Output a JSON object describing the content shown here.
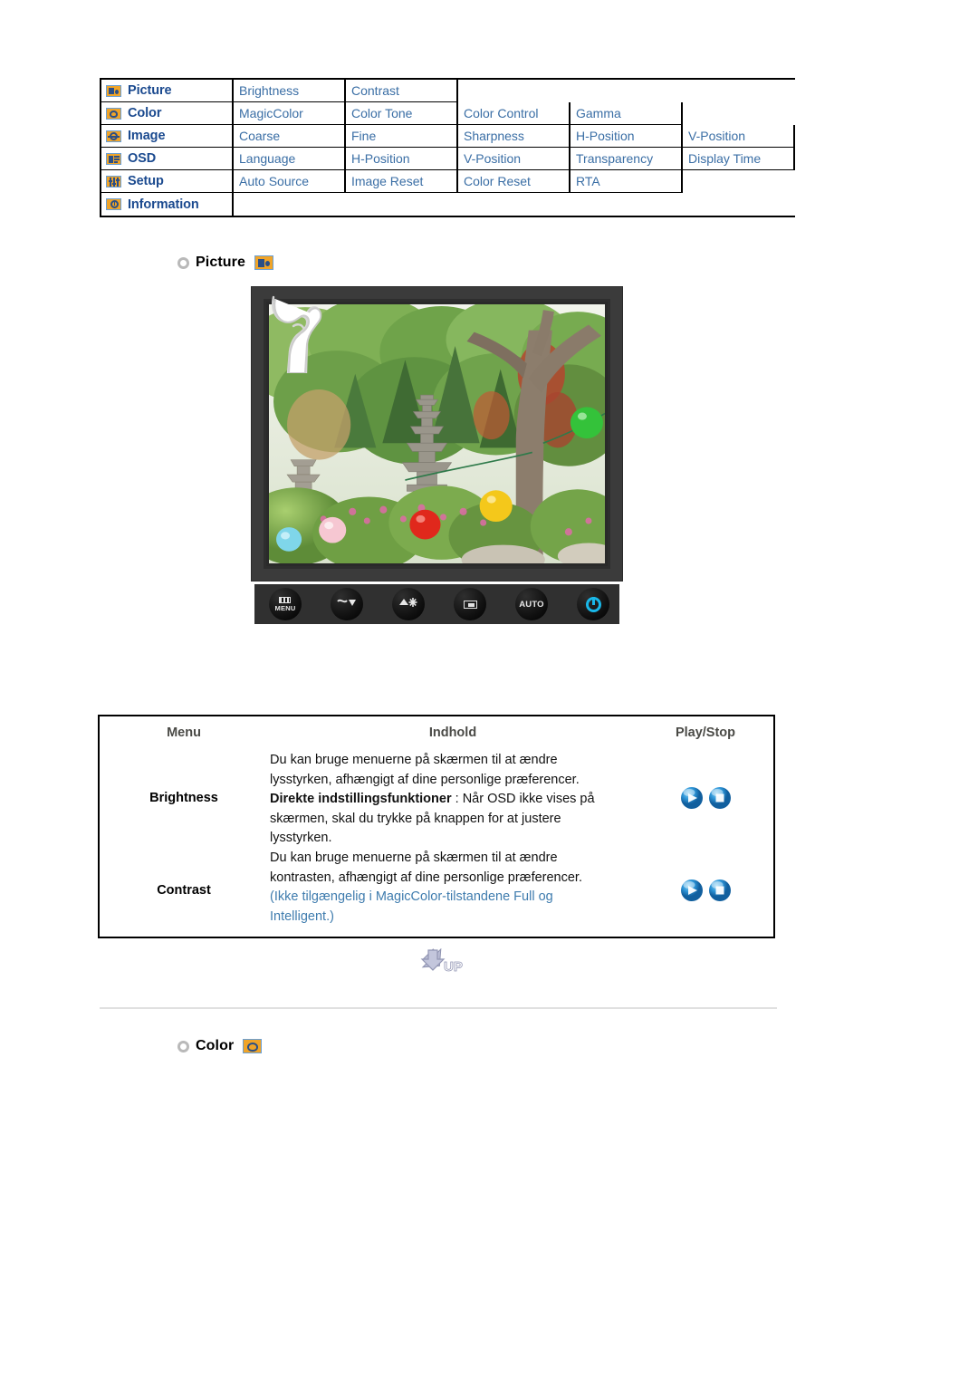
{
  "osd_menu": {
    "rows": [
      {
        "category": "Picture",
        "icon": "picture-icon",
        "items": [
          "Brightness",
          "Contrast"
        ]
      },
      {
        "category": "Color",
        "icon": "color-icon",
        "items": [
          "MagicColor",
          "Color Tone",
          "Color Control",
          "Gamma"
        ]
      },
      {
        "category": "Image",
        "icon": "image-icon",
        "items": [
          "Coarse",
          "Fine",
          "Sharpness",
          "H-Position",
          "V-Position"
        ]
      },
      {
        "category": "OSD",
        "icon": "osd-icon",
        "items": [
          "Language",
          "H-Position",
          "V-Position",
          "Transparency",
          "Display Time"
        ]
      },
      {
        "category": "Setup",
        "icon": "setup-icon",
        "items": [
          "Auto Source",
          "Image Reset",
          "Color Reset",
          "RTA"
        ]
      },
      {
        "category": "Information",
        "icon": "information-icon",
        "items": []
      }
    ]
  },
  "sections": {
    "picture": {
      "title": "Picture",
      "icon": "picture-icon"
    },
    "color": {
      "title": "Color",
      "icon": "color-icon"
    }
  },
  "monitor": {
    "buttons": [
      {
        "name": "menu-button",
        "label": "MENU",
        "glyph": "menu-bars-icon"
      },
      {
        "name": "source-down-button",
        "label": "",
        "glyph": "source-down-icon"
      },
      {
        "name": "brightness-button",
        "label": "",
        "glyph": "brightness-sun-icon"
      },
      {
        "name": "enter-button",
        "label": "",
        "glyph": "enter-icon"
      },
      {
        "name": "auto-button",
        "label": "AUTO",
        "glyph": "auto-text-icon"
      },
      {
        "name": "power-button",
        "label": "",
        "glyph": "power-icon"
      }
    ]
  },
  "desc_table": {
    "headers": {
      "menu": "Menu",
      "content": "Indhold",
      "play_stop": "Play/Stop"
    },
    "rows": [
      {
        "menu": "Brightness",
        "content_lines": [
          {
            "text": "Du kan bruge menuerne på skærmen til at ændre",
            "style": "normal"
          },
          {
            "text": "lysstyrken, afhængigt af dine personlige præferencer.",
            "style": "normal"
          },
          {
            "bold": "Direkte indstillingsfunktioner",
            "text": " : Når OSD ikke vises på",
            "style": "mixed"
          },
          {
            "text": "skærmen, skal du trykke på knappen for at justere",
            "style": "normal"
          },
          {
            "text": "lysstyrken.",
            "style": "normal"
          }
        ],
        "icons": [
          "play-orb-icon",
          "stop-orb-icon"
        ]
      },
      {
        "menu": "Contrast",
        "content_lines": [
          {
            "text": "Du kan bruge menuerne på skærmen til at ændre",
            "style": "normal"
          },
          {
            "text": "kontrasten, afhængigt af dine personlige præferencer.",
            "style": "normal"
          },
          {
            "text": "(Ikke tilgængelig i MagicColor-tilstandene Full og",
            "style": "blue-open"
          },
          {
            "text": "Intelligent.)",
            "style": "blue-close"
          }
        ],
        "icons": [
          "play-orb-icon",
          "stop-orb-icon"
        ]
      }
    ]
  },
  "up_button": {
    "label": "UP",
    "icon": "up-arrow-icon"
  },
  "colors": {
    "menu_category_text": "#1b4a8f",
    "menu_item_text": "#3a6ea5",
    "note_blue": "#3f7cae",
    "icon_orange": "#f0a428",
    "icon_border_blue": "#6a9fd4",
    "header_gray": "#4a4a46",
    "power_cyan": "#19b7e8",
    "divider_gray": "#e0e0e0"
  }
}
